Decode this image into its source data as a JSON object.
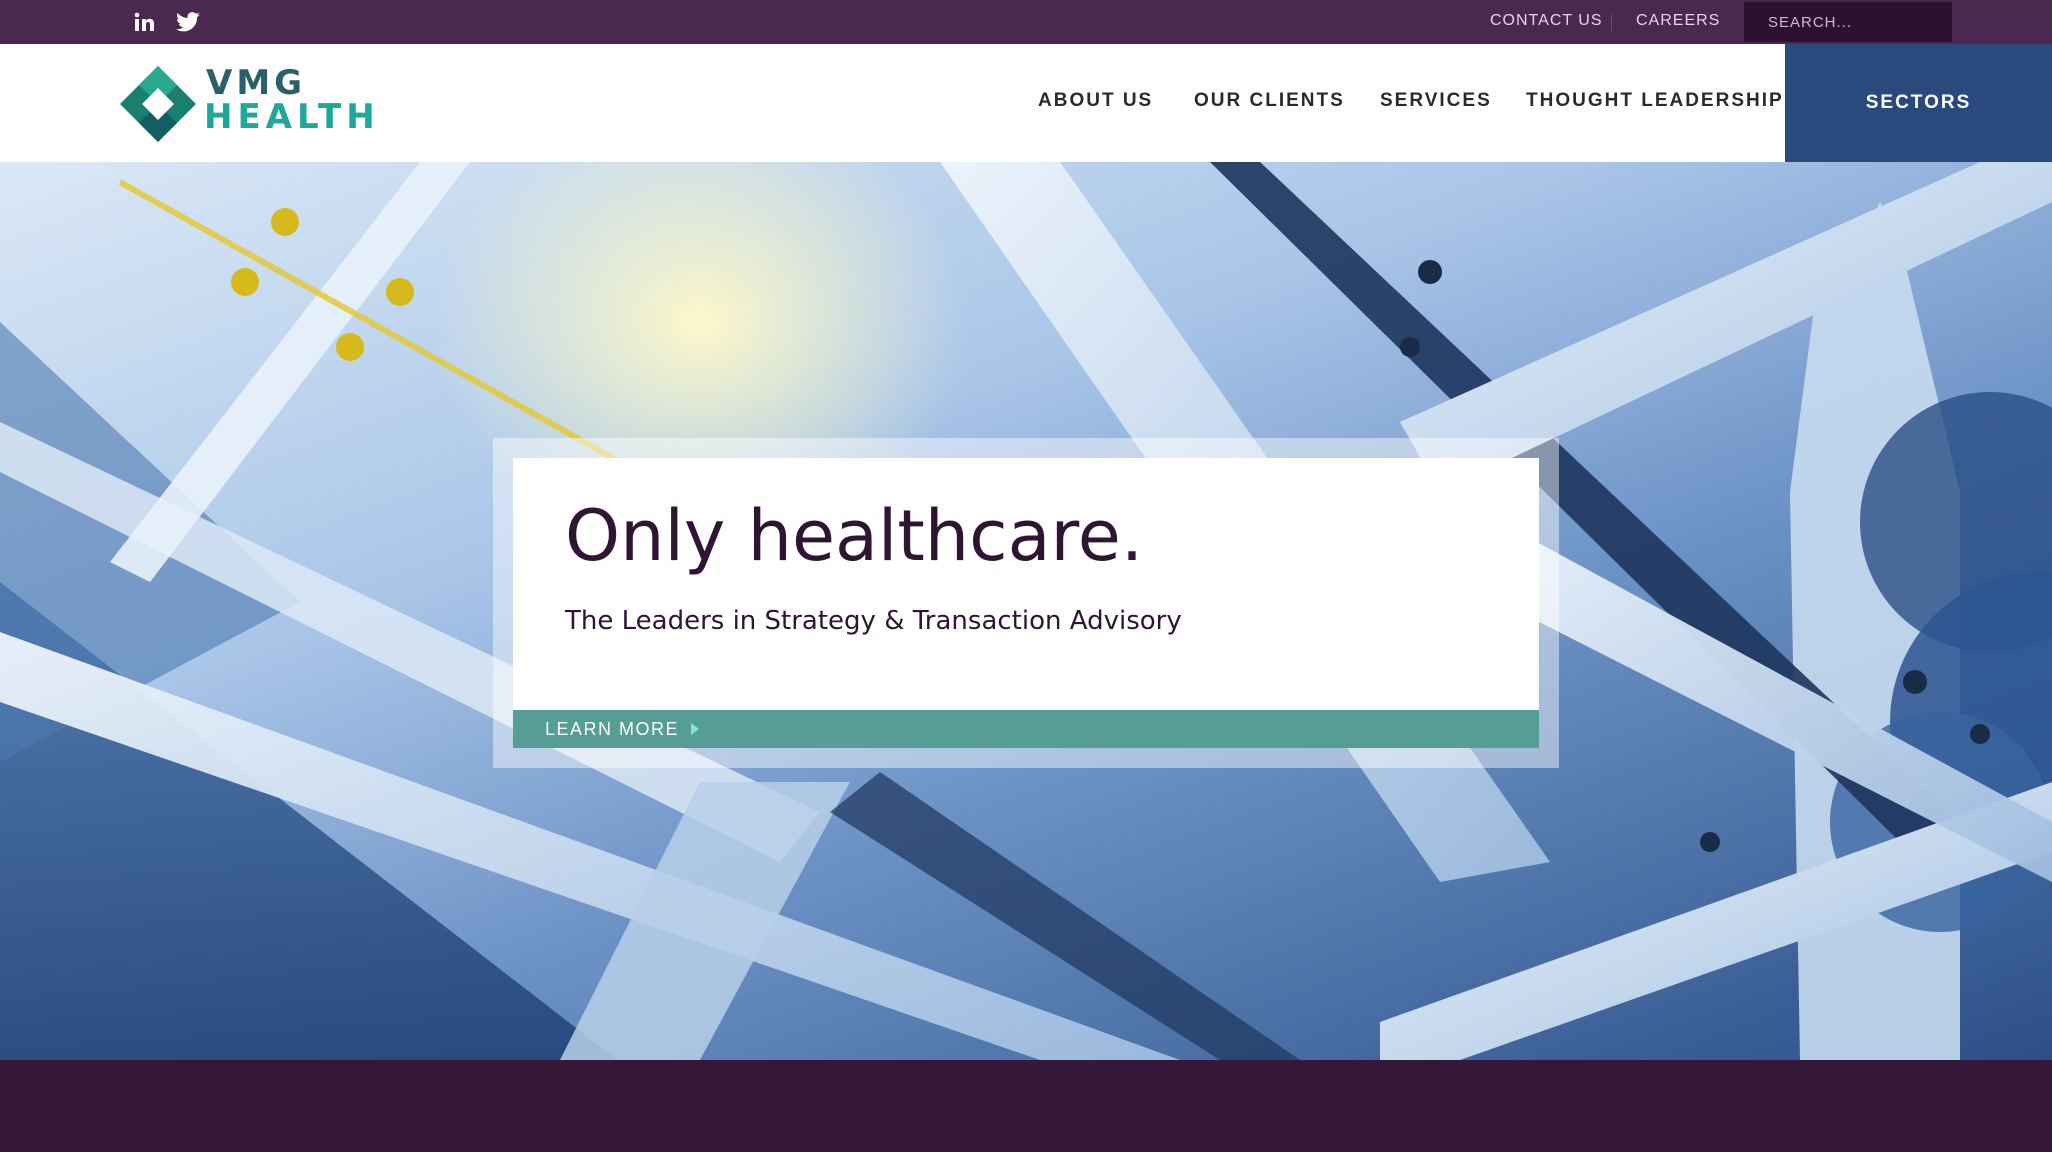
{
  "topbar": {
    "social": [
      "linkedin-icon",
      "twitter-icon"
    ],
    "links": [
      "CONTACT US",
      "CAREERS"
    ],
    "search_placeholder": "SEARCH..."
  },
  "header": {
    "logo": {
      "line1": "VMG",
      "line2": "HEALTH"
    },
    "nav": [
      "ABOUT US",
      "OUR CLIENTS",
      "SERVICES",
      "THOUGHT LEADERSHIP"
    ],
    "cta": "SECTORS"
  },
  "hero": {
    "headline": "Only healthcare.",
    "subheadline": "The Leaders in Strategy & Transaction Advisory",
    "button": "LEARN MORE"
  },
  "colors": {
    "topbar": "#4a2850",
    "sectors": "#2a4a7e",
    "accent_teal": "#569d96",
    "headline": "#2e1532",
    "footer": "#351838"
  }
}
